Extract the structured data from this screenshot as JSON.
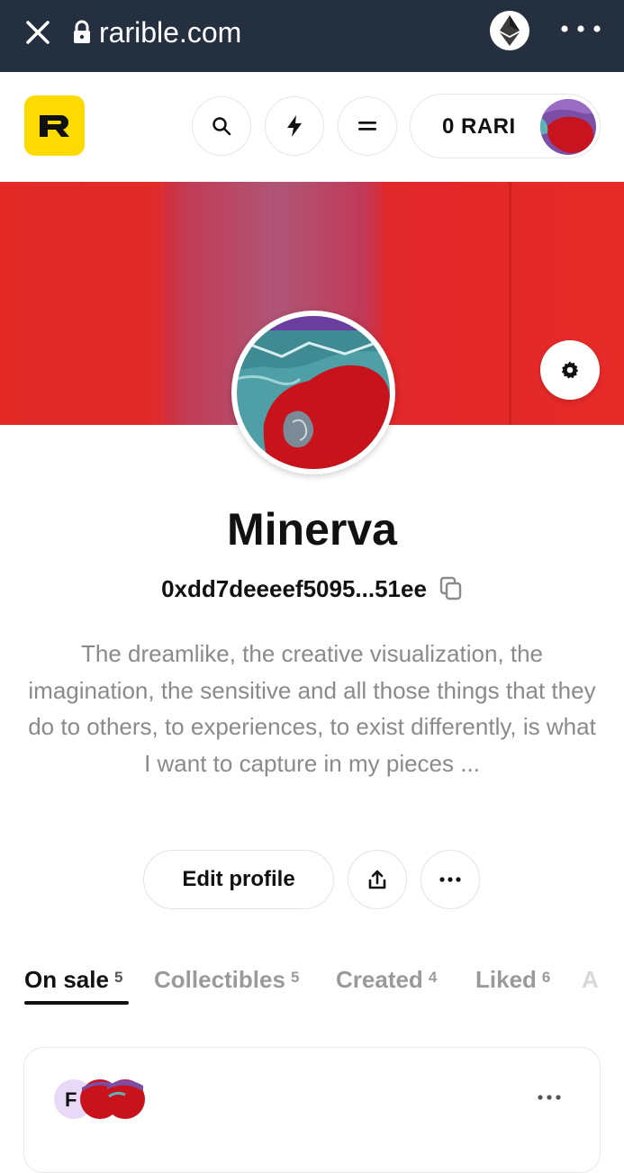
{
  "browser": {
    "url": "rarible.com",
    "close_icon": "close-icon",
    "lock_icon": "lock-icon",
    "eth_icon": "ethereum-icon",
    "menu_icon": "more-horizontal-icon"
  },
  "header": {
    "logo_letter": "R",
    "balance": "0 RARI",
    "buttons": [
      "search-icon",
      "lightning-icon",
      "menu-icon"
    ],
    "accent": "#FEDA03"
  },
  "profile": {
    "name": "Minerva",
    "address": "0xdd7deeeef5095...51ee",
    "bio": "The dreamlike, the creative visualization, the imagination, the sensitive and all those things that they do to others, to experiences, to exist differently, is what I want to capture in my pieces ...",
    "edit_label": "Edit profile"
  },
  "tabs": [
    {
      "label": "On sale",
      "count": "5",
      "active": true
    },
    {
      "label": "Collectibles",
      "count": "5",
      "active": false
    },
    {
      "label": "Created",
      "count": "4",
      "active": false
    },
    {
      "label": "Liked",
      "count": "6",
      "active": false
    },
    {
      "label": "A",
      "count": "",
      "active": false
    }
  ],
  "card": {
    "owner_initial": "F"
  }
}
